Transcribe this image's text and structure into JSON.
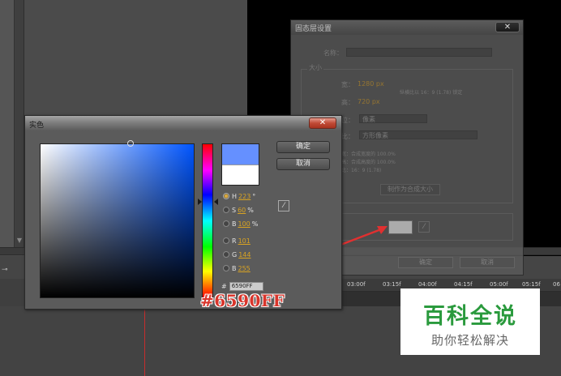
{
  "background": {
    "timeline_ruler": [
      "03:00f",
      "03:15f",
      "04:00f",
      "04:15f",
      "05:00f",
      "05:15f",
      "06"
    ]
  },
  "solid_dialog": {
    "title": "固态层设置",
    "name_label": "名称：",
    "size_group": "大小",
    "width_label": "宽：",
    "width_value": "1280 px",
    "lock_aspect": "纵横比以 16：9 (1.78) 锁定",
    "height_label": "高：",
    "height_value": "720 px",
    "units_label": "位：",
    "units_value": "像素",
    "pixel_aspect_label": "比：",
    "pixel_aspect_value": "方形像素",
    "info_lines": [
      "宽：合成宽度的 100.0%",
      "高：合成高度的 100.0%",
      "比：16：9 (1.78)"
    ],
    "make_comp_size": "制作为合成大小",
    "ok": "确定",
    "cancel": "取消"
  },
  "color_picker": {
    "title": "实色",
    "ok_label": "确定",
    "cancel_label": "取消",
    "fields": [
      {
        "key": "H",
        "value": "223",
        "unit": "°",
        "selected": true
      },
      {
        "key": "S",
        "value": "60",
        "unit": "%",
        "selected": false
      },
      {
        "key": "B",
        "value": "100",
        "unit": "%",
        "selected": false
      },
      {
        "key": "R",
        "value": "101",
        "unit": "",
        "selected": false
      },
      {
        "key": "G",
        "value": "144",
        "unit": "",
        "selected": false
      },
      {
        "key": "B",
        "value": "255",
        "unit": "",
        "selected": false
      }
    ],
    "hex_prefix": "#",
    "hex_value": "6590FF",
    "new_color": "#6590ff",
    "old_color": "#ffffff"
  },
  "annotation": {
    "hex_overlay": "#6590FF",
    "arrow_color": "#e03030"
  },
  "watermark": {
    "main": "百科全说",
    "sub": "助你轻松解决"
  }
}
